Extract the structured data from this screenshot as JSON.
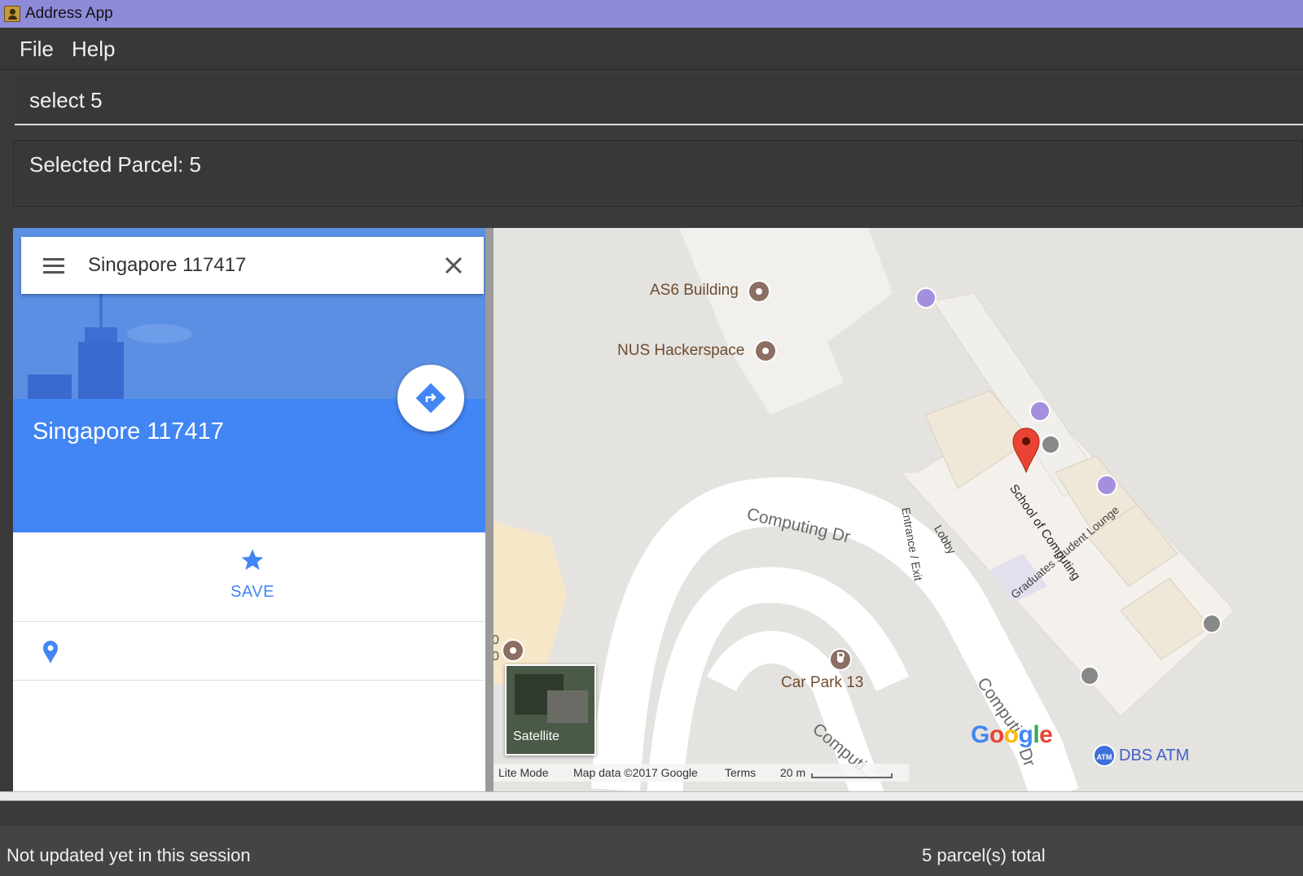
{
  "window": {
    "title": "Address App",
    "icon": "address-book-icon"
  },
  "menubar": {
    "items": [
      "File",
      "Help"
    ]
  },
  "command_box": {
    "value": "select 5"
  },
  "result_display": {
    "text": "Selected Parcel: 5"
  },
  "browser": {
    "search": {
      "query": "Singapore 117417",
      "menu_icon": "hamburger-menu-icon",
      "close_icon": "close-icon"
    },
    "place": {
      "title": "Singapore 117417",
      "directions_icon": "directions-icon"
    },
    "actions": {
      "save_label": "SAVE",
      "save_icon": "star-icon"
    },
    "address_row": {
      "icon": "location-pin-icon"
    },
    "map": {
      "labels": {
        "as6": "AS6 Building",
        "hackerspace": "NUS Hackerspace",
        "carpark": "Car Park 13",
        "computing_dr_1": "Computing Dr",
        "computing_dr_2": "Computi...",
        "computing_dr_3": "Computi",
        "computing_dr_4": "Dr",
        "soc": "School of Computing",
        "entrance": "Entrance / Exit",
        "lobby": "Lobby",
        "lounge": "Graduates Student Lounge",
        "atm": "DBS ATM",
        "atm_badge": "ATM",
        "parking_badge": "P",
        "left_edge_1": "0",
        "left_edge_2": "0"
      },
      "satellite_label": "Satellite",
      "footer": {
        "lite_mode": "Lite Mode",
        "map_data": "Map data ©2017 Google",
        "terms": "Terms",
        "scale": "20 m"
      },
      "logo": "Google",
      "colors": {
        "marker": "#ea4335",
        "accent": "#4285f4"
      }
    }
  },
  "statusbar": {
    "left": "Not updated yet in this session",
    "right": "5 parcel(s) total"
  }
}
